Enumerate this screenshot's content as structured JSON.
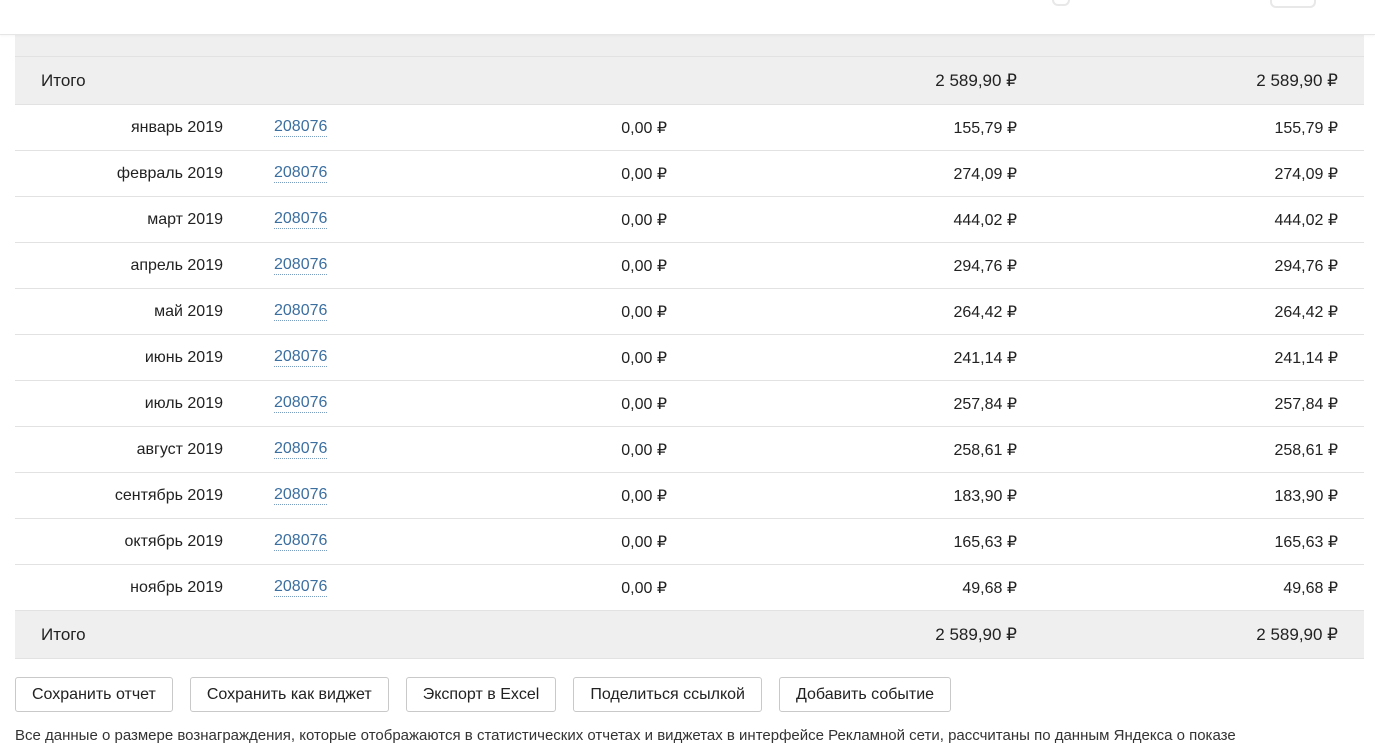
{
  "currency": "₽",
  "total_row": {
    "label": "Итого",
    "v2": "2 589,90 ₽",
    "v3": "2 589,90 ₽"
  },
  "rows": [
    {
      "period": "январь 2019",
      "site": "208076",
      "v1": "0,00 ₽",
      "v2": "155,79 ₽",
      "v3": "155,79 ₽"
    },
    {
      "period": "февраль 2019",
      "site": "208076",
      "v1": "0,00 ₽",
      "v2": "274,09 ₽",
      "v3": "274,09 ₽"
    },
    {
      "period": "март 2019",
      "site": "208076",
      "v1": "0,00 ₽",
      "v2": "444,02 ₽",
      "v3": "444,02 ₽"
    },
    {
      "period": "апрель 2019",
      "site": "208076",
      "v1": "0,00 ₽",
      "v2": "294,76 ₽",
      "v3": "294,76 ₽"
    },
    {
      "period": "май 2019",
      "site": "208076",
      "v1": "0,00 ₽",
      "v2": "264,42 ₽",
      "v3": "264,42 ₽"
    },
    {
      "period": "июнь 2019",
      "site": "208076",
      "v1": "0,00 ₽",
      "v2": "241,14 ₽",
      "v3": "241,14 ₽"
    },
    {
      "period": "июль 2019",
      "site": "208076",
      "v1": "0,00 ₽",
      "v2": "257,84 ₽",
      "v3": "257,84 ₽"
    },
    {
      "period": "август 2019",
      "site": "208076",
      "v1": "0,00 ₽",
      "v2": "258,61 ₽",
      "v3": "258,61 ₽"
    },
    {
      "period": "сентябрь 2019",
      "site": "208076",
      "v1": "0,00 ₽",
      "v2": "183,90 ₽",
      "v3": "183,90 ₽"
    },
    {
      "period": "октябрь 2019",
      "site": "208076",
      "v1": "0,00 ₽",
      "v2": "165,63 ₽",
      "v3": "165,63 ₽"
    },
    {
      "period": "ноябрь 2019",
      "site": "208076",
      "v1": "0,00 ₽",
      "v2": "49,68 ₽",
      "v3": "49,68 ₽"
    }
  ],
  "actions": {
    "save_report": "Сохранить отчет",
    "save_widget": "Сохранить как виджет",
    "export_excel": "Экспорт в Excel",
    "share_link": "Поделиться ссылкой",
    "add_event": "Добавить событие"
  },
  "footnote": "Все данные о размере вознаграждения, которые отображаются в статистических отчетах и виджетах в интерфейсе Рекламной сети, рассчитаны по данным Яндекса о показе",
  "colors": {
    "link": "#3b6fa0",
    "total_bg": "#efefef",
    "divider": "#e2e2e2"
  }
}
